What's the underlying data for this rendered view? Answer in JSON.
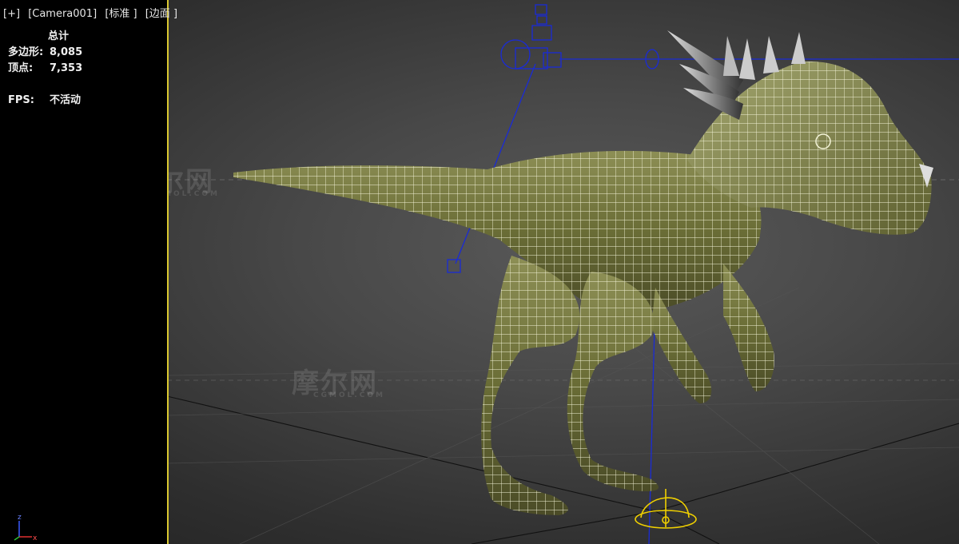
{
  "viewport": {
    "labels": [
      "[+]",
      "[Camera001]",
      "[标准 ]",
      "[边面 ]"
    ]
  },
  "stats": {
    "title": "总计",
    "polygons_label": "多边形:",
    "polygons_value": "8,085",
    "vertices_label": "顶点:",
    "vertices_value": "7,353",
    "fps_label": "FPS:",
    "fps_value": "不活动"
  },
  "watermarks": {
    "text_cn": "摩尔网",
    "text_en": "CGMOL.COM",
    "text_en2": "CGMOL"
  },
  "axis": {
    "z": "z",
    "x": "x"
  },
  "colors": {
    "frame_border": "#d9c730",
    "gizmo_blue": "#1a2bd6",
    "helper_yellow": "#f0d000",
    "wire": "#f4f4d8",
    "skin": "#7e8048"
  }
}
